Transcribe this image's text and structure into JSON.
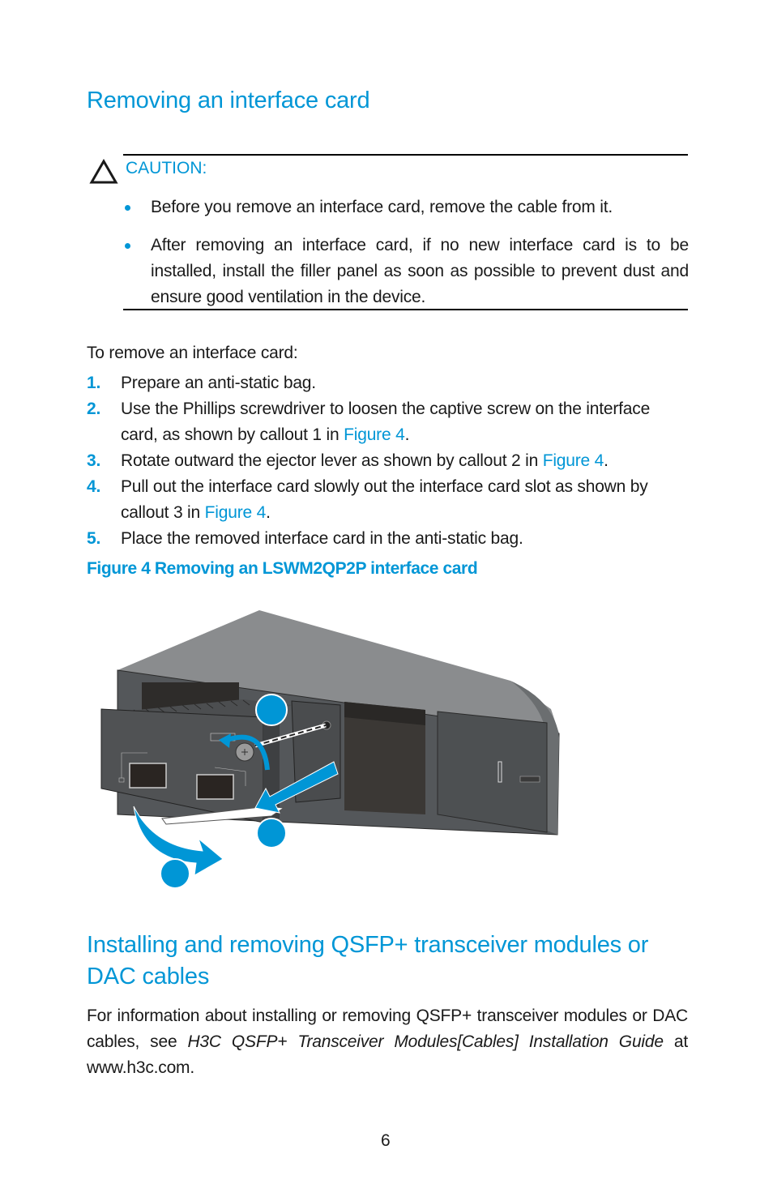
{
  "section1": {
    "title": "Removing an interface card",
    "caution": {
      "icon": "warning-triangle-icon",
      "label": "CAUTION:",
      "bullets": [
        "Before you remove an interface card, remove the cable from it.",
        "After removing an interface card, if no new interface card is to be installed, install the filler panel as soon as possible to prevent dust and ensure good ventilation in the device."
      ]
    },
    "intro": "To remove an interface card:",
    "steps": [
      {
        "num": "1.",
        "text": "Prepare an anti-static bag."
      },
      {
        "num": "2.",
        "text": "Use the Phillips screwdriver to loosen the captive screw on the interface card, as shown by callout 1 in ",
        "link": "Figure 4",
        "after": "."
      },
      {
        "num": "3.",
        "text": "Rotate outward the ejector lever as shown by callout 2 in ",
        "link": "Figure 4",
        "after": "."
      },
      {
        "num": "4.",
        "text": "Pull out the interface card slowly out the interface card slot as shown by callout 3 in ",
        "link": "Figure 4",
        "after": "."
      },
      {
        "num": "5.",
        "text": "Place the removed interface card in the anti-static bag."
      }
    ],
    "figure_caption": "Figure 4 Removing an LSWM2QP2P interface card"
  },
  "section2": {
    "title_line1": "Installing and removing QSFP+ transceiver modules or",
    "title_line2": "DAC cables",
    "para_prefix": "For information about installing or removing QSFP+ transceiver modules or DAC cables, see ",
    "para_italic": "H3C QSFP+ Transceiver Modules[Cables] Installation Guide",
    "para_suffix": " at www.h3c.com."
  },
  "footer": {
    "page_number": "6"
  },
  "colors": {
    "accent": "#0096d6",
    "device_gray": "#54575a",
    "device_top": "#8a8c8e"
  }
}
